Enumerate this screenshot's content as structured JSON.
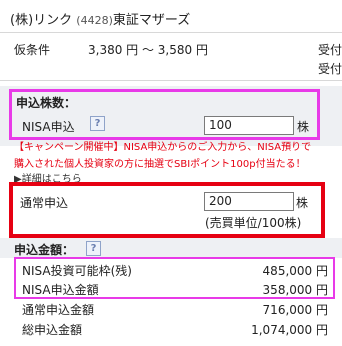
{
  "header": {
    "company": "(株)リンク",
    "code": "(4428)",
    "market": "東証マザーズ"
  },
  "condition": {
    "label": "仮条件",
    "value": "3,380 円 ～ 3,580 円"
  },
  "right_labels": [
    "受付",
    "受付"
  ],
  "order": {
    "section_title": "申込株数：",
    "nisa_label": "NISA申込",
    "nisa_value": "100",
    "share_unit": "株",
    "campaign_line1": "【キャンペーン開催中】NISA申込からのご入力から、NISA預りで",
    "campaign_line2": "購入された個人投資家の方に抽選でSBIポイント100p付当たる！",
    "details_link": "▶詳細はこちら",
    "normal_label": "通常申込",
    "normal_value": "200",
    "normal_unit": "株",
    "trade_unit_note": "(売買単位/100株)"
  },
  "amounts": {
    "section_title": "申込金額：",
    "rows": [
      {
        "label": "NISA投資可能枠(残)",
        "value": "485,000 円"
      },
      {
        "label": "NISA申込金額",
        "value": "358,000 円"
      },
      {
        "label": "通常申込金額",
        "value": "716,000 円"
      },
      {
        "label": "総申込金額",
        "value": "1,074,000 円"
      }
    ]
  },
  "help_icon_text": "?",
  "colors": {
    "highlight_pink": "#e83ae8",
    "highlight_red": "#e60012",
    "campaign_text": "#e60012"
  }
}
